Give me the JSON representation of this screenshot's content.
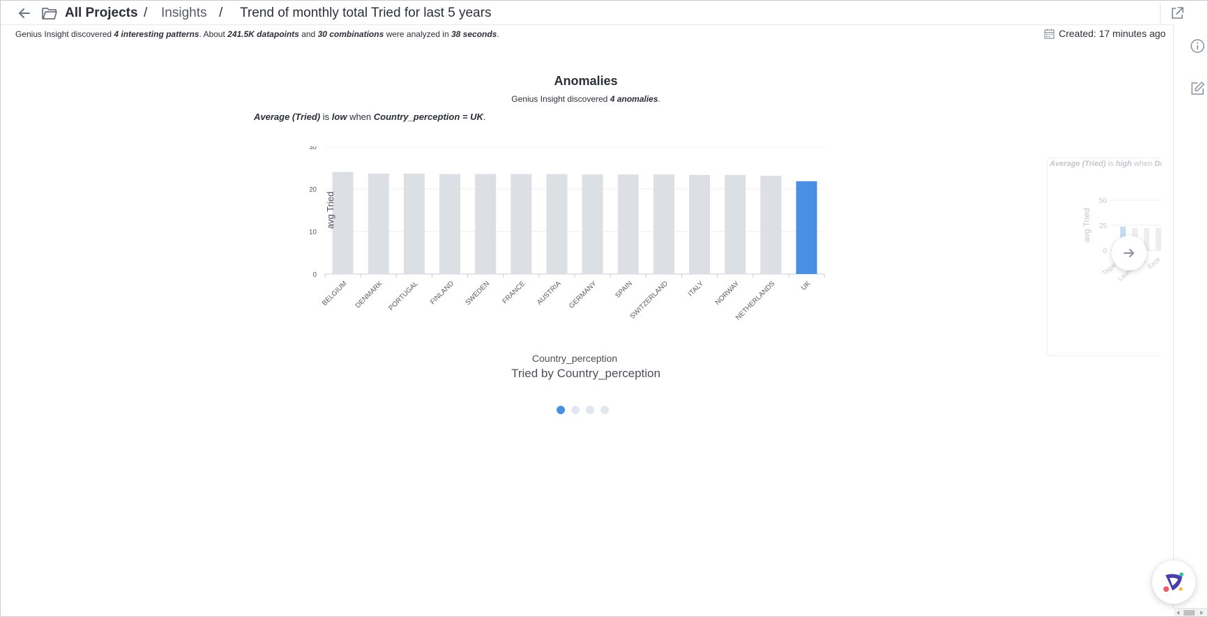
{
  "header": {
    "root_label": "All Projects",
    "separator": "/",
    "insights_label": "Insights",
    "title": "Trend of monthly total Tried for last 5 years"
  },
  "summary": {
    "prefix": "Genius Insight discovered ",
    "patterns": "4 interesting patterns",
    "mid1": ". About ",
    "datapoints": "241.5K datapoints",
    "mid2": " and ",
    "combinations": "30 combinations",
    "mid3": " were analyzed in ",
    "duration": "38 seconds",
    "suffix": "."
  },
  "created": {
    "label": "Created: 17 minutes ago"
  },
  "card": {
    "title": "Anomalies",
    "sub_prefix": "Genius Insight discovered ",
    "sub_count": "4 anomalies",
    "sub_suffix": ".",
    "pattern_measure": "Average (Tried)",
    "pattern_is": " is ",
    "pattern_level": "low",
    "pattern_when": " when ",
    "pattern_condition": "Country_perception = UK",
    "pattern_end": ".",
    "caption": "Tried by Country_perception"
  },
  "chart_data": {
    "type": "bar",
    "categories": [
      "BELGIUM",
      "DENMARK",
      "PORTUGAL",
      "FINLAND",
      "SWEDEN",
      "FRANCE",
      "AUSTRIA",
      "GERMANY",
      "SPAIN",
      "SWITZERLAND",
      "ITALY",
      "NORWAY",
      "NETHERLANDS",
      "UK"
    ],
    "values": [
      24.0,
      23.6,
      23.6,
      23.5,
      23.5,
      23.5,
      23.5,
      23.4,
      23.4,
      23.4,
      23.3,
      23.3,
      23.1,
      21.8
    ],
    "highlight": "UK",
    "xlabel": "Country_perception",
    "ylabel": "avg Tried",
    "ylim": [
      0,
      30
    ],
    "yticks": [
      "0",
      "10",
      "20",
      "30"
    ],
    "colors": {
      "bar": "#dcdfe3",
      "highlight": "#4a90e2",
      "grid": "#ececec"
    }
  },
  "pagination": {
    "count": 4,
    "active": 0
  },
  "preview": {
    "measure": "Average (Tried)",
    "is": " is ",
    "level": "high",
    "when": " when ",
    "condition": "Dr",
    "ylabel": "avg Tried",
    "yticks": [
      "0",
      "25",
      "50"
    ],
    "xlabels": [
      "Tagamet",
      "Launch Log",
      "Exce"
    ]
  },
  "icons": {
    "back": "arrow-left-icon",
    "folder": "folder-open-icon",
    "share": "share-icon",
    "info": "info-icon",
    "edit": "edit-icon",
    "calendar": "calendar-icon",
    "next": "arrow-right-icon",
    "assistant": "assistant-logo-icon"
  }
}
